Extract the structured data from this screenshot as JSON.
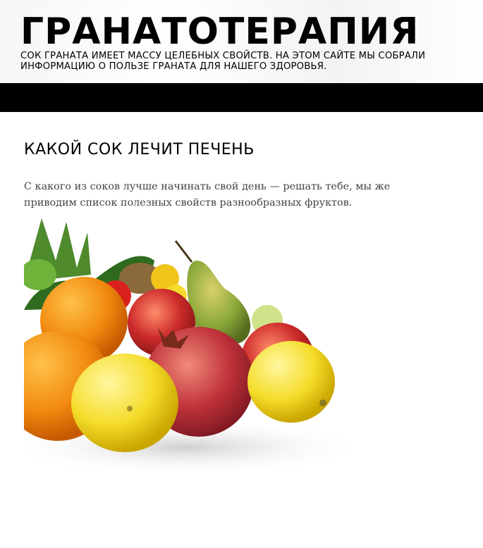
{
  "site": {
    "title": "ГРАНАТОТЕРАПИЯ",
    "description": "СОК ГРАНАТА ИМЕЕТ МАССУ ЦЕЛЕБНЫХ СВОЙСТВ. НА ЭТОМ САЙТЕ МЫ СОБРАЛИ ИНФОРМАЦИЮ О ПОЛЬЗЕ ГРАНАТА ДЛЯ НАШЕГО ЗДОРОВЬЯ."
  },
  "post": {
    "title": "КАКОЙ СОК ЛЕЧИТ ПЕЧЕНЬ",
    "excerpt": "С какого из соков лучше начинать свой день — решать тебе, мы же приводим список полезных свойств разнообразных фруктов.",
    "image": {
      "icon": "fruit-photo",
      "colors": {
        "orange": "#f28a10",
        "lemon": "#f5dc2a",
        "pomegranate": "#c0323a",
        "pear": "#8aa83a",
        "apple": "#cc2a2a"
      }
    }
  },
  "colors": {
    "navbar": "#000000",
    "text": "#111111",
    "excerpt": "#444444"
  }
}
